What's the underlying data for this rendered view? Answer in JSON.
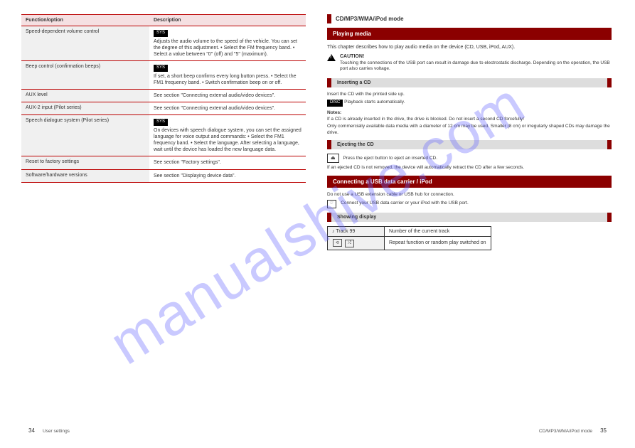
{
  "watermark": "manualshive.com",
  "left_page": {
    "table_header": {
      "title": "Function/option",
      "desc": "Description"
    },
    "rows": [
      {
        "title": "Speed-dependent volume control",
        "chip": "SYS",
        "desc": "Adjusts the audio volume to the speed of the vehicle. You can set the degree of this adjustment.\n• Select the FM frequency band.\n• Select a value between \"0\" (off) and \"5\" (maximum)."
      },
      {
        "title": "Beep control (confirmation beeps)",
        "chip": "SYS",
        "desc": "If set, a short beep confirms every long button press.\n• Select the FM1 frequency band.\n• Switch confirmation beep on or off."
      },
      {
        "title": "AUX level",
        "desc": "See section \"Connecting external audio/video devices\"."
      },
      {
        "title": "AUX-2 input (Pilot series)",
        "desc": "See section \"Connecting external audio/video devices\"."
      },
      {
        "title": "Speech dialogue system (Pilot series)",
        "chip": "SYS",
        "desc": "On devices with speech dialogue system, you can set the assigned language for voice output and commands:\n• Select the FM1 frequency band.\n• Select the language.\nAfter selecting a language, wait until the device has loaded the new language data."
      },
      {
        "title": "Reset to factory settings",
        "desc": "See section \"Factory settings\"."
      },
      {
        "title": "Software/hardware versions",
        "desc": "See section \"Displaying device data\"."
      }
    ],
    "page_num": "34",
    "footer": "User settings"
  },
  "right_page": {
    "section_title": "CD/MP3/WMA/iPod mode",
    "section_bar": "Playing media",
    "intro": "This chapter describes how to play audio media on the device (CD, USB, iPod, AUX).",
    "warning_title": "CAUTION!",
    "warning_text": "Touching the connections of the USB port can result in damage due to electrostatic discharge. Depending on the operation, the USB port also carries voltage.",
    "insert_cd_header": "Inserting a CD",
    "insert_cd_body": "Insert the CD with the printed side up.",
    "insert_cd_chip": "DISC",
    "insert_cd_after": "Playback starts automatically.",
    "notes_header": "Notes:",
    "note1": "If a CD is already inserted in the drive, the drive is blocked. Do not insert a second CD forcefully!",
    "note2": "Only commercially available data media with a diameter of 12 cm may be used. Smaller (8 cm) or irregularly shaped CDs may damage the drive.",
    "eject_header": "Ejecting the CD",
    "eject_body": "Press the eject button to eject an inserted CD.",
    "eject_note": "If an ejected CD is not removed, the device will automatically retract the CD after a few seconds.",
    "usb_header": "Connecting a USB data carrier / iPod",
    "usb_note": "Do not use a USB extension cable or USB hub for connection.",
    "usb_body": "Connect your USB data carrier or your iPod with the USB port.",
    "display_header": "Showing display",
    "display_table": [
      {
        "icon": "♪ Track 99",
        "desc": "Number of the current track"
      },
      {
        "icon_type": "repeat",
        "desc": "Repeat function or random play switched on"
      }
    ],
    "page_num": "35",
    "footer": "CD/MP3/WMA/iPod mode"
  }
}
